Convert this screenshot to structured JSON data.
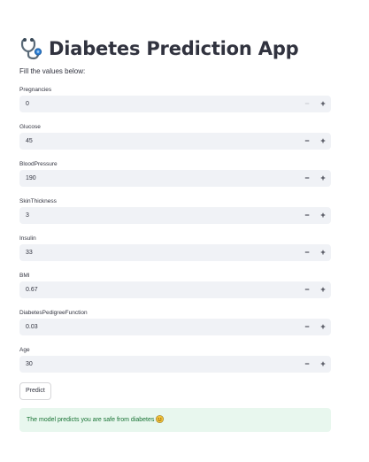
{
  "header": {
    "title": "Diabetes Prediction App",
    "icon": "stethoscope-icon"
  },
  "form": {
    "instruction": "Fill the values below:",
    "fields": [
      {
        "label": "Pregnancies",
        "value": "0",
        "minus_disabled": true
      },
      {
        "label": "Glucose",
        "value": "45",
        "minus_disabled": false
      },
      {
        "label": "BloodPressure",
        "value": "190",
        "minus_disabled": false
      },
      {
        "label": "SkinThickness",
        "value": "3",
        "minus_disabled": false
      },
      {
        "label": "Insulin",
        "value": "33",
        "minus_disabled": false
      },
      {
        "label": "BMI",
        "value": "0.67",
        "minus_disabled": false
      },
      {
        "label": "DiabetesPedigreeFunction",
        "value": "0.03",
        "minus_disabled": false
      },
      {
        "label": "Age",
        "value": "30",
        "minus_disabled": false
      }
    ],
    "stepper_minus": "−",
    "stepper_plus": "+"
  },
  "actions": {
    "predict_label": "Predict"
  },
  "result": {
    "message": "The model predicts you are safe from diabetes",
    "emoji_icon": "smiley-face-icon"
  },
  "colors": {
    "text": "#31333f",
    "input_bg": "#f0f2f6",
    "success_bg": "#e8f7ee",
    "success_text": "#177233"
  }
}
